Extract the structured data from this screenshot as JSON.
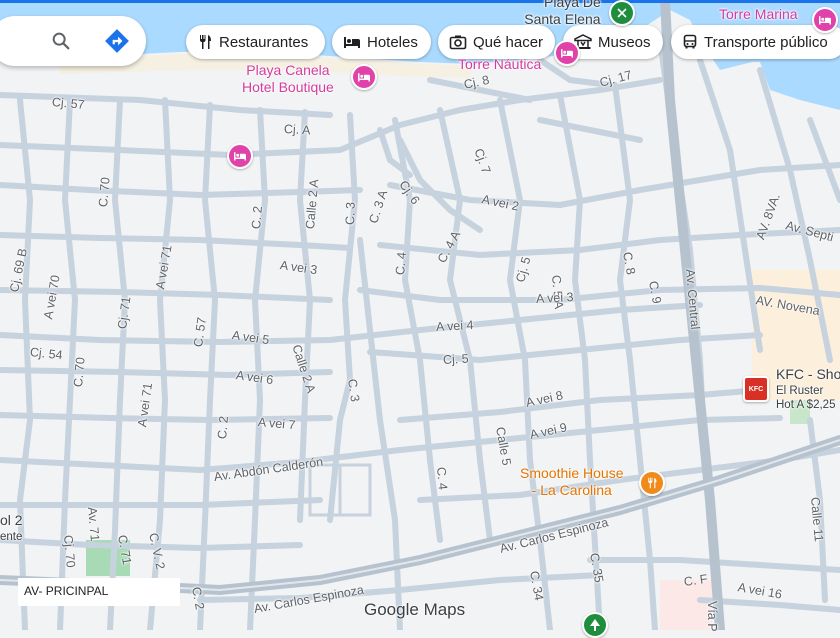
{
  "search": {
    "search_icon": "search-icon",
    "directions_icon": "directions-icon"
  },
  "chips": [
    {
      "label": "Restaurantes",
      "icon": "fork-knife-icon"
    },
    {
      "label": "Hoteles",
      "icon": "bed-icon"
    },
    {
      "label": "Qué hacer",
      "icon": "camera-icon"
    },
    {
      "label": "Museos",
      "icon": "museum-icon"
    },
    {
      "label": "Transporte público",
      "icon": "bus-icon"
    }
  ],
  "places": {
    "playa_canela_l1": "Playa Canela",
    "playa_canela_l2": "Hotel Boutique",
    "torre_nautica": "Torre Náutica",
    "playa_de_l1": "Playa De",
    "playa_de_l2": "Santa Elena",
    "torre_marina": "Torre Marina",
    "smoothie_l1": "Smoothie House",
    "smoothie_l2": "- La Carolina",
    "kfc_name": "KFC - Sho",
    "kfc_line2": "El Ruster",
    "kfc_line3": "Hot A $2,25",
    "kfc_badge": "KFC",
    "left_l1": "ol 2",
    "left_l2": "ente"
  },
  "streets": {
    "cj57": "Cj. 57",
    "cja": "Cj. A",
    "cj8": "Cj. 8",
    "cj17": "Cj. 17",
    "cj7": "Cj. 7",
    "c70_top": "C. 70",
    "c2_top": "C. 2",
    "calle2a_top": "Calle 2 A",
    "c3_top": "C. 3",
    "c3a": "C. 3 A",
    "cj6": "Cj. 6",
    "c4a": "C. 4 A",
    "c4_top": "C. 4",
    "avei2": "A vei 2",
    "c5a": "C. 5 A",
    "cj5_top": "Cj. 5",
    "c8": "C. 8",
    "c9": "C. 9",
    "avcentral": "Av. Central",
    "av8va": "AV. 8VA.",
    "avsept": "Av. Septi",
    "avnovena": "AV. Novena",
    "cj69b": "Cj. 69 B",
    "avei70": "A vei 70",
    "avei71_top": "A vei 71",
    "cj71": "Cj. 71",
    "c57": "C. 57",
    "avei3_l": "A vei 3",
    "avei3_r": "A vei 3",
    "avei4": "A vei 4",
    "avei5": "A vei 5",
    "cj5": "Cj. 5",
    "cj54": "Cj. 54",
    "c70_mid": "C. 70",
    "calle2a_mid": "Calle 2 A",
    "c3_mid": "C. 3",
    "avei6": "A vei 6",
    "avei71_bot": "A vei 71",
    "c2_mid": "C. 2",
    "avei7": "A vei 7",
    "avei8": "A vei 8",
    "avei9": "A vei 9",
    "calle5": "Calle 5",
    "abdon": "Av. Abdón Calderón",
    "c4_bot": "C. 4",
    "cj70": "Cj. 70",
    "av71": "Av. 71",
    "c71": "C. 71",
    "cv2": "C. V. 2",
    "c2_bot": "C. 2",
    "carlos_main": "Av. Carlos Espinoza",
    "carlos_bot": "Av. Carlos Espinoza",
    "c34": "C. 34",
    "c35": "C. 35",
    "cf": "C. F",
    "avei16": "A vei 16",
    "viap": "Vía P",
    "calle11": "Calle 11"
  },
  "overlay": {
    "label": "AV- PRICINPAL"
  },
  "branding": {
    "google": "Google",
    "maps": "Maps"
  },
  "colors": {
    "water": "#aadaff",
    "land": "#f1f3f4",
    "road": "#c6d2dd",
    "park": "#a8dab5",
    "commercial": "#fcefdc",
    "hotel_pin": "#e042a9",
    "food_pin": "#f08b1b"
  }
}
